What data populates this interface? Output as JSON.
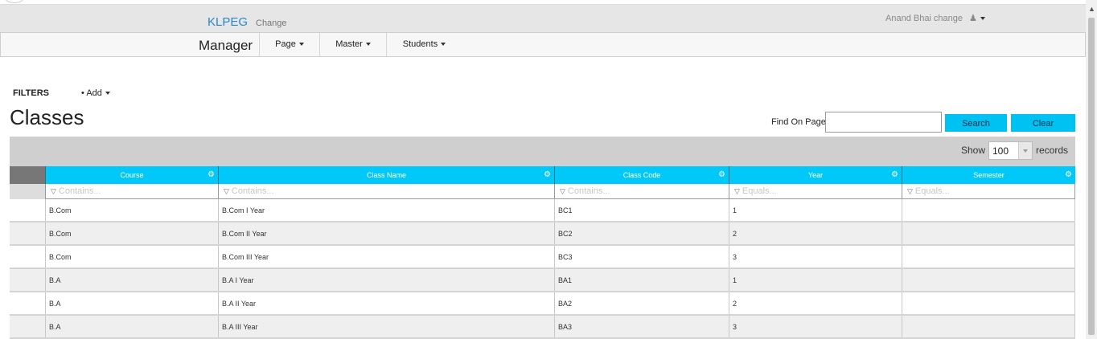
{
  "app": {
    "brand": "KLPEG",
    "brand_change": "Change",
    "user": "Anand Bhai change"
  },
  "nav": {
    "title": "Manager",
    "items": [
      {
        "label": "Page"
      },
      {
        "label": "Master"
      },
      {
        "label": "Students"
      }
    ]
  },
  "filters": {
    "title": "FILTERS",
    "add_label": "Add"
  },
  "page": {
    "title": "Classes"
  },
  "search": {
    "label": "Find On Page",
    "value": "",
    "search_button": "Search",
    "clear_button": "Clear"
  },
  "table": {
    "show_label": "Show",
    "page_size": "100",
    "records_label": "records",
    "columns": [
      {
        "label": "Course",
        "filter_placeholder": "Contains..."
      },
      {
        "label": "Class Name",
        "filter_placeholder": "Contains..."
      },
      {
        "label": "Class Code",
        "filter_placeholder": "Contains..."
      },
      {
        "label": "Year",
        "filter_placeholder": "Equals..."
      },
      {
        "label": "Semester",
        "filter_placeholder": "Equals..."
      }
    ],
    "rows": [
      [
        "B.Com",
        "B.Com I Year",
        "BC1",
        "1",
        ""
      ],
      [
        "B.Com",
        "B.Com II Year",
        "BC2",
        "2",
        ""
      ],
      [
        "B.Com",
        "B.Com III Year",
        "BC3",
        "3",
        ""
      ],
      [
        "B.A",
        "B.A I Year",
        "BA1",
        "1",
        ""
      ],
      [
        "B.A",
        "B.A II Year",
        "BA2",
        "2",
        ""
      ],
      [
        "B.A",
        "B.A III Year",
        "BA3",
        "3",
        ""
      ]
    ]
  },
  "colors": {
    "accent": "#00c8f8",
    "brand": "#2a88c8",
    "header_bg": "#e6e6e6"
  },
  "icons": {
    "user": "user-icon",
    "column_settings": "gear-icon",
    "filter": "funnel-icon"
  }
}
